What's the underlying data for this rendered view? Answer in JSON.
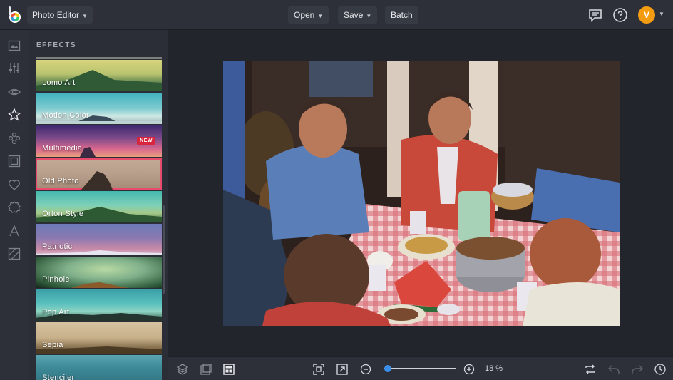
{
  "topbar": {
    "app_menu": "Photo Editor",
    "open_label": "Open",
    "save_label": "Save",
    "batch_label": "Batch",
    "avatar_initial": "V",
    "icons": [
      "chat-icon",
      "help-icon"
    ]
  },
  "left_rail": {
    "icons": [
      "image-icon",
      "sliders-icon",
      "eye-icon",
      "star-icon",
      "flower-icon",
      "frame-icon",
      "heart-icon",
      "badge-icon",
      "text-icon",
      "texture-icon"
    ],
    "active_icon": "star-icon"
  },
  "effects_panel": {
    "title": "EFFECTS",
    "items": [
      {
        "label": "Lomo Art",
        "badge": ""
      },
      {
        "label": "Motion Color",
        "badge": ""
      },
      {
        "label": "Multimedia",
        "badge": "NEW"
      },
      {
        "label": "Old Photo",
        "badge": ""
      },
      {
        "label": "Orton Style",
        "badge": ""
      },
      {
        "label": "Patriotic",
        "badge": ""
      },
      {
        "label": "Pinhole",
        "badge": ""
      },
      {
        "label": "Pop Art",
        "badge": ""
      },
      {
        "label": "Sepia",
        "badge": ""
      },
      {
        "label": "Stenciler",
        "badge": ""
      }
    ],
    "selected": "Old Photo"
  },
  "bottombar": {
    "zoom_label": "18 %",
    "zoom_value": 0.05,
    "icons": [
      "layers-icon",
      "crop-overlay-icon",
      "layout-icon",
      "fit-screen-icon",
      "expand-icon",
      "zoom-out-icon",
      "zoom-in-icon",
      "swap-icon",
      "undo-icon",
      "redo-icon",
      "history-icon"
    ]
  },
  "colors": {
    "accent": "#3b8fe8",
    "selection": "#e84b6c",
    "avatar": "#f39c12",
    "badge": "#d7263d"
  }
}
